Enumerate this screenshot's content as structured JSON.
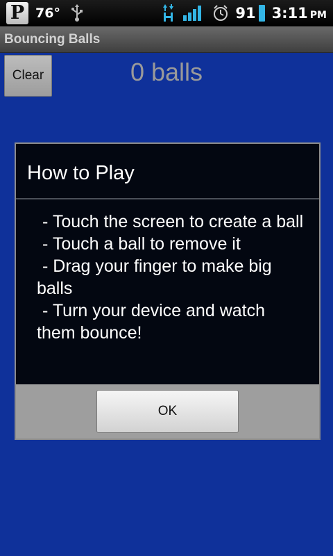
{
  "status_bar": {
    "p_label": "P",
    "temperature": "76°",
    "battery_level": "91",
    "clock_time": "3:11",
    "clock_ampm": "PM",
    "icons": [
      "usb-icon",
      "hsdpa-data-icon",
      "signal-icon",
      "alarm-icon",
      "battery-icon"
    ],
    "battery_color": "#33b5e5"
  },
  "app": {
    "title": "Bouncing Balls",
    "background_color": "#0f319a"
  },
  "main": {
    "clear_label": "Clear",
    "ball_count": "0 balls"
  },
  "dialog": {
    "title": "How to Play",
    "instructions": [
      " - Touch the screen to create a ball",
      " - Touch a ball to remove it",
      " - Drag your finger to make big balls",
      " - Turn your device and watch them bounce!"
    ],
    "ok_label": "OK"
  }
}
